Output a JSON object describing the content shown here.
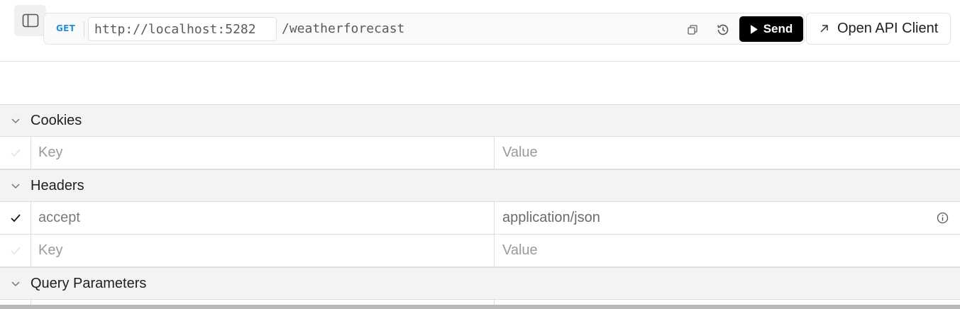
{
  "request": {
    "method": "GET",
    "base_url": "http://localhost:5282",
    "path": "/weatherforecast",
    "send_label": "Send",
    "open_client_label": "Open API Client"
  },
  "icons": {
    "sidebar_toggle": "sidebar-toggle-icon",
    "copy": "copy-icon",
    "history": "history-icon",
    "play": "play-icon",
    "external_link": "arrow-up-right-icon",
    "chevron": "chevron-down-icon",
    "check": "check-icon",
    "info": "info-icon"
  },
  "colors": {
    "method": "#1f8fde",
    "send_bg": "#000000",
    "section_bg": "#f3f3f3"
  },
  "sections": {
    "cookies": {
      "title": "Cookies",
      "rows": [
        {
          "key": "Key",
          "value": "Value",
          "enabled": false,
          "is_placeholder": true
        }
      ]
    },
    "headers": {
      "title": "Headers",
      "rows": [
        {
          "key": "accept",
          "value": "application/json",
          "enabled": true,
          "is_placeholder": false
        },
        {
          "key": "Key",
          "value": "Value",
          "enabled": false,
          "is_placeholder": true
        }
      ]
    },
    "query": {
      "title": "Query Parameters"
    }
  }
}
